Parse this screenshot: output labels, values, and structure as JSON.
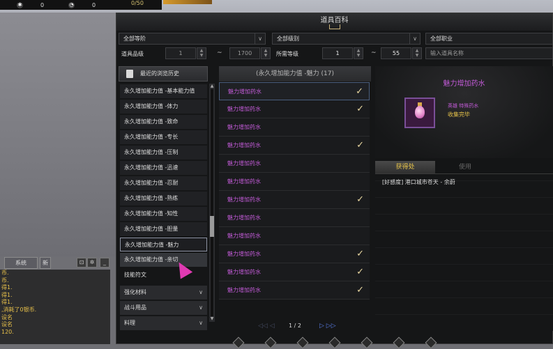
{
  "hud": {
    "stat1": "0",
    "stat2": "0",
    "counter": "0/50"
  },
  "chat": {
    "tab_label": "系统",
    "new_label": "新",
    "lines": [
      "币.",
      "币.",
      "得1.",
      "得1.",
      "得1.",
      ",消耗了0银币.",
      "设名",
      "设名",
      "120."
    ]
  },
  "window": {
    "title": "道具百科"
  },
  "filters": {
    "level_select": "全部等阶",
    "grade_select": "全部级别",
    "job_select": "全部职业",
    "quality_label": "道具品级",
    "quality_min": "1",
    "quality_max": "1700",
    "req_level_label": "所需等级",
    "req_min": "1",
    "req_max": "55",
    "tilde": "~",
    "search_placeholder": "输入道具名称"
  },
  "categories": {
    "history_label": "最近的浏览历史",
    "items": [
      "永久增加能力值 -基本能力值",
      "永久增加能力值 -体力",
      "永久增加能力值 -致命",
      "永久增加能力值 -专长",
      "永久增加能力值 -压制",
      "永久增加能力值 -迅速",
      "永久增加能力值 -忍耐",
      "永久增加能力值 -熟练",
      "永久增加能力值 -知性",
      "永久增加能力值 -胆量",
      "永久增加能力值 -魅力",
      "永久增加能力值 -亲切",
      "技能符文"
    ],
    "groups": [
      "强化材料",
      "战斗用品",
      "料理"
    ]
  },
  "item_list": {
    "header": "(永久增加能力值 -魅力 (17)",
    "rows": [
      {
        "name": "魅力增加药水",
        "collected": true
      },
      {
        "name": "魅力增加药水",
        "collected": true
      },
      {
        "name": "魅力增加药水",
        "collected": false
      },
      {
        "name": "魅力增加药水",
        "collected": true
      },
      {
        "name": "魅力增加药水",
        "collected": false
      },
      {
        "name": "魅力增加药水",
        "collected": false
      },
      {
        "name": "魅力增加药水",
        "collected": true
      },
      {
        "name": "魅力增加药水",
        "collected": false
      },
      {
        "name": "魅力增加药水",
        "collected": false
      },
      {
        "name": "魅力增加药水",
        "collected": true
      },
      {
        "name": "魅力增加药水",
        "collected": true
      },
      {
        "name": "魅力增加药水",
        "collected": true
      }
    ],
    "page": "1 / 2",
    "check_glyph": "✓"
  },
  "detail": {
    "name": "魅力增加药水",
    "tag": "英雄 特殊药水",
    "status": "收集完毕",
    "tab_acquire": "获得处",
    "tab_use": "使用",
    "location": "[好感度] 港口城市苍天 - 余蔚"
  },
  "colors": {
    "epic_purple": "#c35bd8",
    "gold": "#e6c34a",
    "panel_bg": "#151617"
  }
}
